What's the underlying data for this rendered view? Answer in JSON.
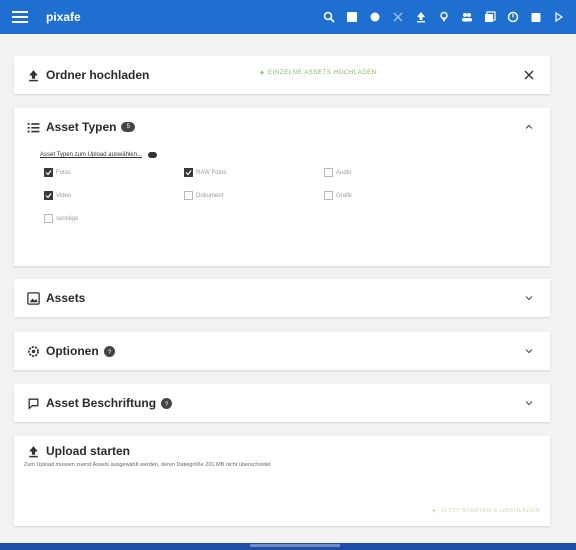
{
  "appbar": {
    "brand": "pixafe",
    "icons": [
      "search-icon",
      "image-icon",
      "settings-icon",
      "share-icon",
      "upload-icon",
      "location-icon",
      "people-icon",
      "album-icon",
      "schedule-icon",
      "calendar-icon",
      "sidebar-icon"
    ]
  },
  "upload_folder": {
    "title": "Ordner hochladen",
    "action_label": "EINZELNE ASSETS HOCHLADEN"
  },
  "asset_types": {
    "title": "Asset Typen",
    "count": "5",
    "hint": "Asset Typen zum Upload auswählen...",
    "options": [
      {
        "label": "Fotos",
        "checked": true
      },
      {
        "label": "RAW Fotos",
        "checked": true
      },
      {
        "label": "Audio",
        "checked": false
      },
      {
        "label": "Video",
        "checked": true
      },
      {
        "label": "Dokument",
        "checked": false
      },
      {
        "label": "Grafik",
        "checked": false
      },
      {
        "label": "sonstige",
        "checked": false
      }
    ]
  },
  "assets": {
    "title": "Assets"
  },
  "options": {
    "title": "Optionen"
  },
  "captions": {
    "title": "Asset Beschriftung"
  },
  "upload_start": {
    "title": "Upload starten",
    "text": "Zum Upload müssen zuerst Assets ausgewählt werden, deren Dateigröße 201 MB nicht überschreitet",
    "button_label": "JETZT STARTEN & HOCHLADEN"
  },
  "colors": {
    "appbar": "#1e6fcf",
    "accent": "#7bbf5a",
    "footer": "#1e4fa8"
  }
}
